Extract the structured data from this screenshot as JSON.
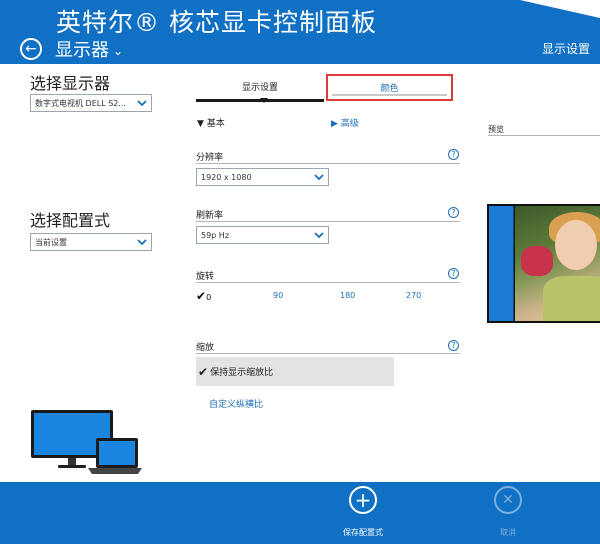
{
  "header": {
    "app_title": "英特尔® 核芯显卡控制面板",
    "section": "显示器",
    "right_title": "显示设置"
  },
  "left": {
    "select_display_label": "选择显示器",
    "display_value": "数字式电视机 DELL S2...",
    "select_profile_label": "选择配置式",
    "profile_value": "当前设置"
  },
  "tabs": [
    {
      "label": "显示设置"
    },
    {
      "label": "颜色"
    }
  ],
  "modes": {
    "basic": "▼ 基本",
    "advanced": "▶ 高级"
  },
  "resolution": {
    "label": "分辨率",
    "value": "1920 x 1080"
  },
  "refresh": {
    "label": "刷新率",
    "value": "59p Hz"
  },
  "rotation": {
    "label": "旋转",
    "options": [
      "0",
      "90",
      "180",
      "270"
    ],
    "selected": "0"
  },
  "scaling": {
    "label": "缩放",
    "option": "保持显示缩放比",
    "custom_link": "自定义纵横比"
  },
  "preview": {
    "label": "预览"
  },
  "footer": {
    "save_label": "保存配置式",
    "cancel_label": "取消"
  },
  "colors": {
    "brand_blue": "#0f70c4",
    "link_blue": "#1d6fb8",
    "highlight_red": "#e03a3a"
  },
  "icons": {
    "back": "back-arrow-icon",
    "help": "help-icon",
    "add": "plus-circle-icon",
    "cancel": "x-circle-icon"
  }
}
